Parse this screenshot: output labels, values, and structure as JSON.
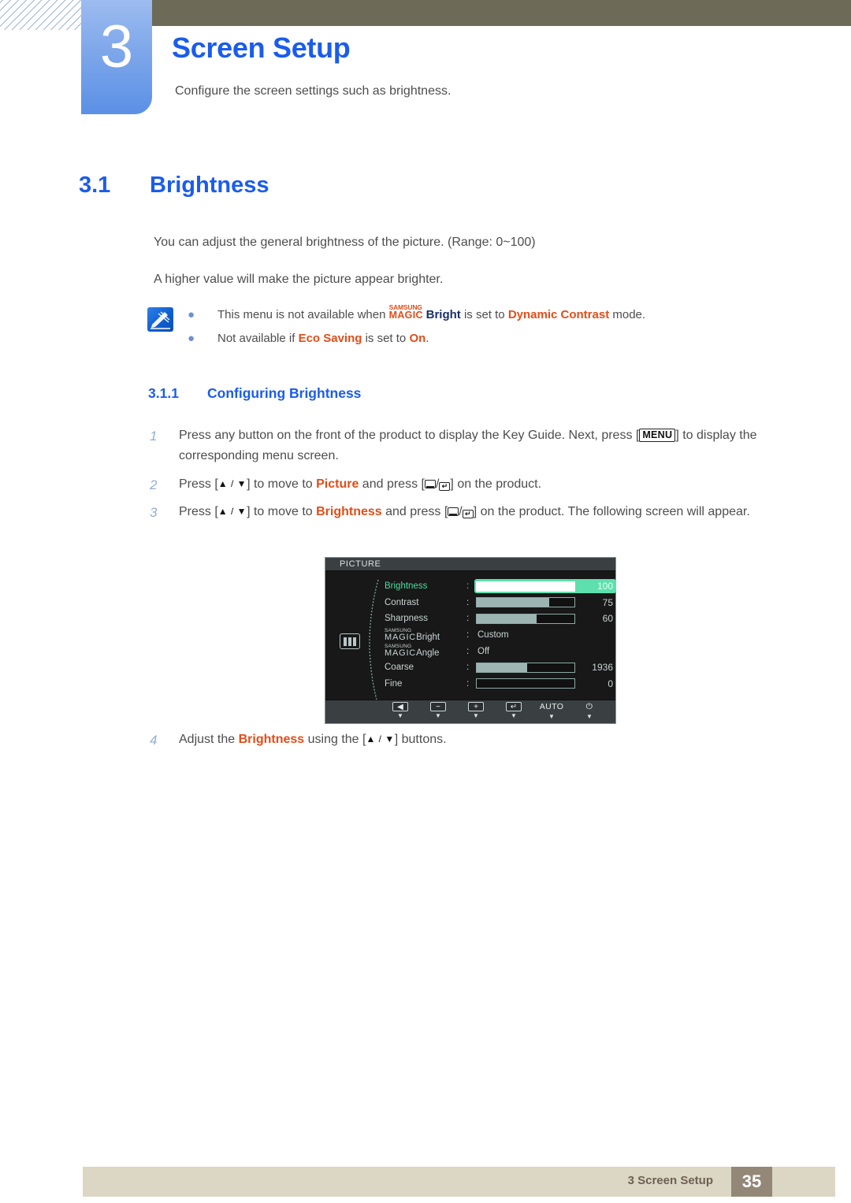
{
  "header": {
    "chapter_number": "3",
    "chapter_title": "Screen Setup",
    "chapter_subtitle": "Configure the screen settings such as brightness."
  },
  "section": {
    "number": "3.1",
    "title": "Brightness",
    "paragraphs": [
      "You can adjust the general brightness of the picture. (Range: 0~100)",
      "A higher value will make the picture appear brighter."
    ]
  },
  "note": {
    "icon": "note-pen-icon",
    "bullets": [
      {
        "prefix": "This menu is not available when ",
        "magic_top": "SAMSUNG",
        "magic_bottom": "MAGIC",
        "magic_suffix": "Bright",
        "middle": " is set to ",
        "highlight": "Dynamic Contrast",
        "suffix": " mode."
      },
      {
        "prefix": "Not available if ",
        "highlight": "Eco Saving",
        "middle": " is set to ",
        "highlight2": "On",
        "suffix": "."
      }
    ]
  },
  "subsection": {
    "number": "3.1.1",
    "title": "Configuring Brightness"
  },
  "steps": [
    {
      "num": "1",
      "part_a": "Press any button on the front of the product to display the Key Guide. Next, press [",
      "key": "MENU",
      "part_b": "] to display the corresponding menu screen."
    },
    {
      "num": "2",
      "part_a": "Press [",
      "arrows": "▲ / ▼",
      "part_b": "] to move to ",
      "highlight": "Picture",
      "part_c": " and press [",
      "part_d": "] on the product."
    },
    {
      "num": "3",
      "part_a": "Press [",
      "arrows": "▲ / ▼",
      "part_b": "] to move to ",
      "highlight": "Brightness",
      "part_c": " and press [",
      "part_d": "] on the product. The following screen will appear."
    },
    {
      "num": "4",
      "part_a": "Adjust the ",
      "highlight": "Brightness",
      "part_b": " using the [",
      "arrows": "▲ / ▼",
      "part_c": "] buttons."
    }
  ],
  "osd": {
    "title": "PICTURE",
    "left_icon": "picture-mode-icon",
    "rows": [
      {
        "label": "Brightness",
        "type": "bar",
        "value": "100",
        "fill_pct": 100,
        "selected": true
      },
      {
        "label": "Contrast",
        "type": "bar",
        "value": "75",
        "fill_pct": 75,
        "selected": false
      },
      {
        "label": "Sharpness",
        "type": "bar",
        "value": "60",
        "fill_pct": 60,
        "selected": false
      },
      {
        "label_magic_top": "SAMSUNG",
        "label_magic_bottom": "MAGIC",
        "label_magic_suffix": "Bright",
        "type": "text",
        "value": "Custom",
        "selected": false
      },
      {
        "label_magic_top": "SAMSUNG",
        "label_magic_bottom": "MAGIC",
        "label_magic_suffix": "Angle",
        "type": "text",
        "value": "Off",
        "selected": false
      },
      {
        "label": "Coarse",
        "type": "bar",
        "value": "1936",
        "fill_pct": 52,
        "selected": false
      },
      {
        "label": "Fine",
        "type": "bar",
        "value": "0",
        "fill_pct": 0,
        "selected": false
      }
    ],
    "buttons": [
      {
        "name": "back-button",
        "glyph": "◀",
        "caret": "▼"
      },
      {
        "name": "minus-button",
        "glyph": "−",
        "caret": "▼"
      },
      {
        "name": "plus-button",
        "glyph": "+",
        "caret": "▼"
      },
      {
        "name": "enter-button",
        "glyph": "↵",
        "caret": "▼"
      },
      {
        "name": "auto-button",
        "glyph": "AUTO",
        "caret": "▼"
      },
      {
        "name": "power-button",
        "glyph": "⏻",
        "caret": "▼"
      }
    ]
  },
  "footer": {
    "text": "3 Screen Setup",
    "page": "35"
  },
  "colors": {
    "heading_blue": "#1a5ced",
    "highlight_orange": "#e24d18",
    "header_olive": "#6d6b57",
    "chapter_blue": "#5b90e6",
    "footer_beige": "#dcd6c4",
    "footer_page_brown": "#938878",
    "osd_selected_green": "#5de0ae"
  }
}
